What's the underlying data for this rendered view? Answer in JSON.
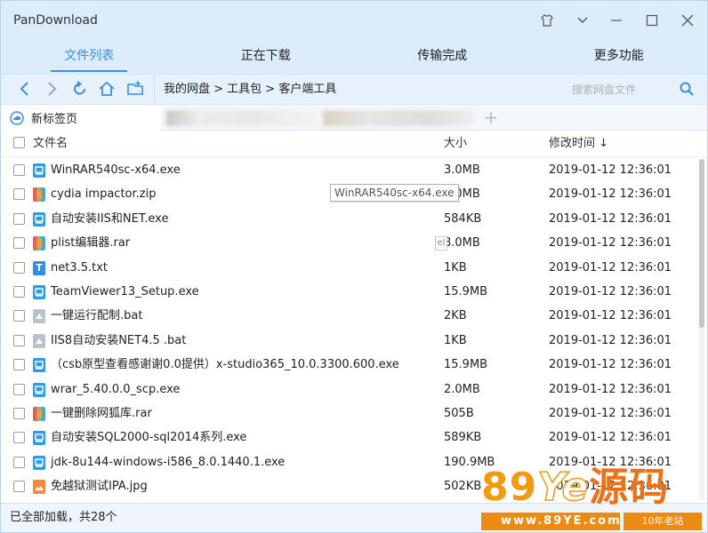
{
  "window": {
    "title": "PanDownload"
  },
  "tabs": [
    {
      "label": "文件列表",
      "active": true
    },
    {
      "label": "正在下载",
      "active": false
    },
    {
      "label": "传输完成",
      "active": false
    },
    {
      "label": "更多功能",
      "active": false
    }
  ],
  "toolbar": {
    "breadcrumb": "我的网盘 > 工具包 > 客户端工具",
    "search_placeholder": "搜索网盘文件",
    "accent": "#3d8fe6"
  },
  "tabstrip": {
    "new_tab_label": "新标签页"
  },
  "list": {
    "headers": {
      "name": "文件名",
      "size": "大小",
      "modified": "修改时间 ↓"
    },
    "rows": [
      {
        "name": "WinRAR540sc-x64.exe",
        "size": "3.0MB",
        "date": "2019-01-12 12:36:01",
        "icon": "exe-icon"
      },
      {
        "name": "cydia impactor.zip",
        "size": "8.0MB",
        "date": "2019-01-12 12:36:01",
        "icon": "archive-icon"
      },
      {
        "name": "自动安装IIS和NET.exe",
        "size": "584KB",
        "date": "2019-01-12 12:36:01",
        "icon": "exe-icon"
      },
      {
        "name": "plist编辑器.rar",
        "size": "8.0MB",
        "date": "2019-01-12 12:36:01",
        "icon": "archive-icon"
      },
      {
        "name": "net3.5.txt",
        "size": "1KB",
        "date": "2019-01-12 12:36:01",
        "icon": "text-icon"
      },
      {
        "name": "TeamViewer13_Setup.exe",
        "size": "15.9MB",
        "date": "2019-01-12 12:36:01",
        "icon": "exe-icon"
      },
      {
        "name": "一键运行配制.bat",
        "size": "2KB",
        "date": "2019-01-12 12:36:01",
        "icon": "bat-icon"
      },
      {
        "name": "IIS8自动安装NET4.5 .bat",
        "size": "1KB",
        "date": "2019-01-12 12:36:01",
        "icon": "bat-icon"
      },
      {
        "name": "（csb原型查看感谢谢0.0提供）x-studio365_10.0.3300.600.exe",
        "size": "15.9MB",
        "date": "2019-01-12 12:36:01",
        "icon": "exe-icon"
      },
      {
        "name": "wrar_5.40.0.0_scp.exe",
        "size": "2.0MB",
        "date": "2019-01-12 12:36:01",
        "icon": "exe-icon"
      },
      {
        "name": "一键删除网狐库.rar",
        "size": "505B",
        "date": "2019-01-12 12:36:01",
        "icon": "archive-icon"
      },
      {
        "name": "自动安装SQL2000-sql2014系列.exe",
        "size": "589KB",
        "date": "2019-01-12 12:36:01",
        "icon": "exe-icon"
      },
      {
        "name": "jdk-8u144-windows-i586_8.0.1440.1.exe",
        "size": "190.9MB",
        "date": "2019-01-12 12:36:01",
        "icon": "exe-icon"
      },
      {
        "name": "免越狱测试IPA.jpg",
        "size": "502KB",
        "date": "2019-01-12 12:36:01",
        "icon": "image-icon"
      }
    ]
  },
  "tooltip": {
    "text": "WinRAR540sc-x64.exe"
  },
  "footer": {
    "status": "已全部加载，共28个"
  },
  "watermark": {
    "brand_89": "89",
    "brand_ye": "Ye",
    "brand_cn": "源码",
    "url": "www.89YE.com",
    "slogan": "10年老站"
  },
  "icon_colors": {
    "exe-icon": "#2e9be6",
    "archive-icon": "#e9a23b",
    "text-icon": "#2e8ee8",
    "bat-icon": "#b9c3cc",
    "image-icon": "#f08a3c"
  }
}
